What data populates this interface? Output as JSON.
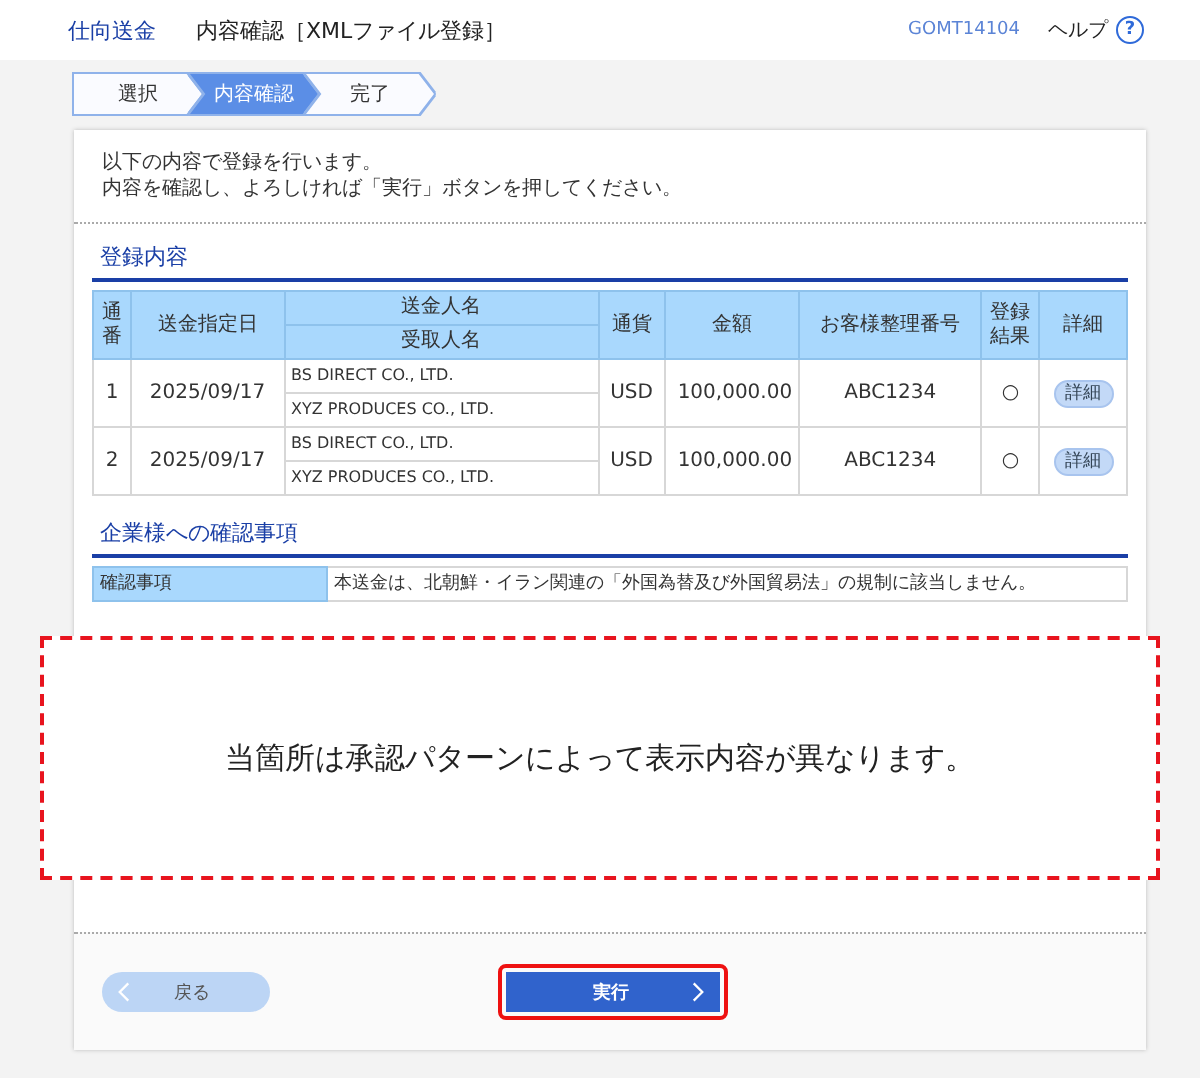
{
  "header": {
    "app_title": "仕向送金",
    "title": "内容確認［XMLファイル登録］",
    "screen_id": "GOMT14104",
    "help": "ヘルプ",
    "help_icon": "?"
  },
  "steps": [
    {
      "label": "選択",
      "selected": false
    },
    {
      "label": "内容確認",
      "selected": true
    },
    {
      "label": "完了",
      "selected": false
    }
  ],
  "intro": [
    "以下の内容で登録を行います。",
    "内容を確認し、よろしければ「実行」ボタンを押してください。"
  ],
  "registration": {
    "title": "登録内容",
    "header": {
      "no": "通番",
      "date": "送金指定日",
      "sender": "送金人名",
      "receiver": "受取人名",
      "currency": "通貨",
      "amount": "金額",
      "ref": "お客様整理番号",
      "result": "登録結果",
      "detail": "詳細"
    },
    "rows": [
      {
        "no": "1",
        "date": "2025/09/17",
        "sender": "BS DIRECT CO., LTD.",
        "receiver": "XYZ PRODUCES CO., LTD.",
        "currency": "USD",
        "amount": "100,000.00",
        "ref": "ABC1234",
        "result": "○",
        "detail": "詳細"
      },
      {
        "no": "2",
        "date": "2025/09/17",
        "sender": "BS DIRECT CO., LTD.",
        "receiver": "XYZ PRODUCES CO., LTD.",
        "currency": "USD",
        "amount": "100,000.00",
        "ref": "ABC1234",
        "result": "○",
        "detail": "詳細"
      }
    ]
  },
  "confirmation": {
    "title": "企業様への確認事項",
    "rows": [
      {
        "label": "確認事項",
        "value": "本送金は、北朝鮮・イラン関連の「外国為替及び外国貿易法」の規制に該当しません。"
      }
    ]
  },
  "note": {
    "text": "当箇所は承認パターンによって表示内容が異なります。"
  },
  "buttons": {
    "back": {
      "label": "戻る",
      "disabled": true
    },
    "execute": {
      "label": "実行",
      "highlighted": true
    }
  }
}
